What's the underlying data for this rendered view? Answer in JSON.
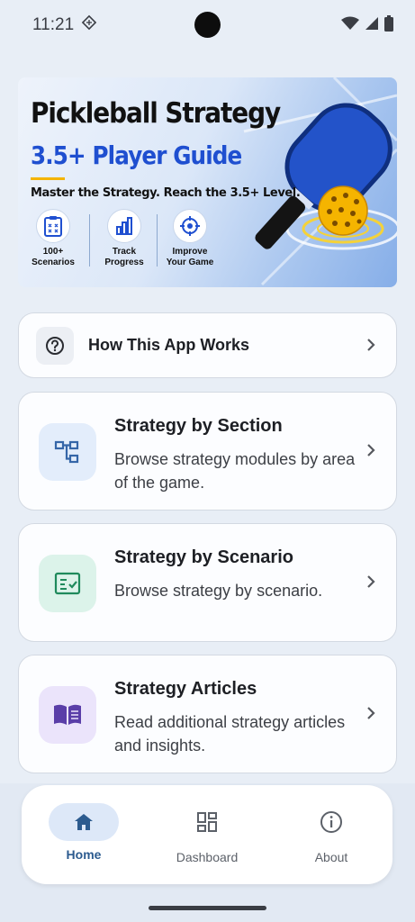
{
  "status_bar": {
    "time": "11:21"
  },
  "banner": {
    "title": "Pickleball Strategy",
    "subtitle": "3.5+ Player Guide",
    "tagline": "Master the Strategy. Reach the 3.5+ Level.",
    "features": [
      {
        "line1": "100+",
        "line2": "Scenarios",
        "icon": "clipboard-icon"
      },
      {
        "line1": "Track",
        "line2": "Progress",
        "icon": "bar-chart-icon"
      },
      {
        "line1": "Improve",
        "line2": "Your Game",
        "icon": "target-icon"
      }
    ]
  },
  "help_card": {
    "title": "How This App Works",
    "icon": "help-circle-icon"
  },
  "cards": [
    {
      "title": "Strategy by Section",
      "description": "Browse strategy modules by area of the game.",
      "icon": "hierarchy-icon"
    },
    {
      "title": "Strategy by Scenario",
      "description": "Browse strategy by scenario.",
      "icon": "checklist-icon"
    },
    {
      "title": "Strategy Articles",
      "description": "Read additional strategy articles and insights.",
      "icon": "book-icon"
    }
  ],
  "nav": {
    "items": [
      {
        "label": "Home",
        "icon": "home-icon",
        "active": true
      },
      {
        "label": "Dashboard",
        "icon": "dashboard-icon",
        "active": false
      },
      {
        "label": "About",
        "icon": "info-icon",
        "active": false
      }
    ]
  },
  "colors": {
    "accent": "#2c5b8f",
    "banner_blue": "#1f4fd0",
    "highlight": "#f4b400"
  }
}
